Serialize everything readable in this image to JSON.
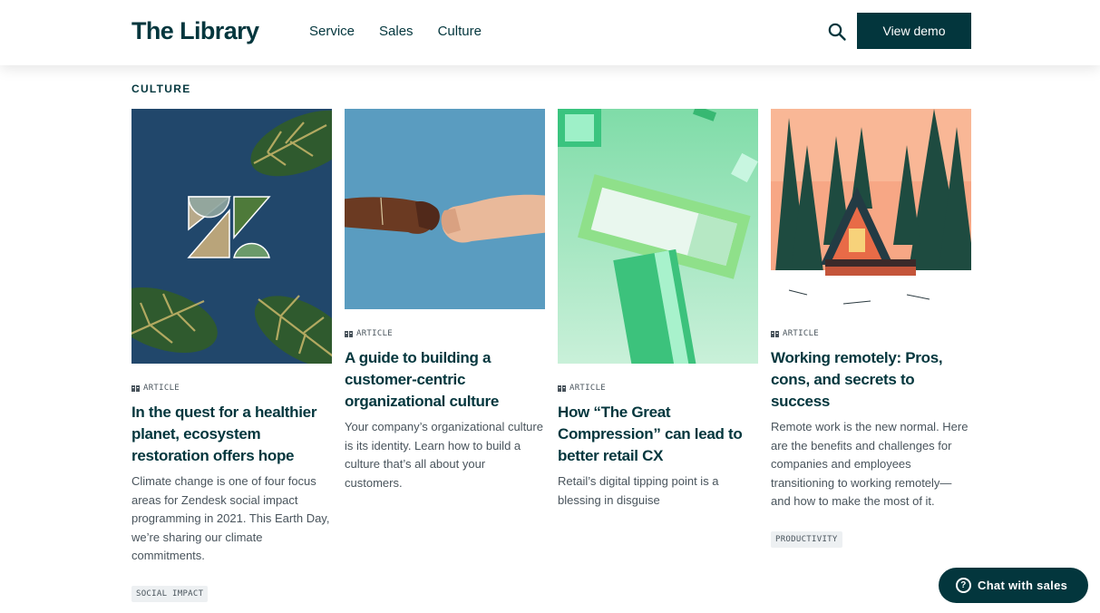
{
  "header": {
    "logo": "The Library",
    "nav": [
      "Service",
      "Sales",
      "Culture"
    ],
    "search_icon": "search-icon",
    "demo_label": "View demo"
  },
  "section": {
    "label": "CULTURE"
  },
  "cards": [
    {
      "type": "ARTICLE",
      "title": "In the quest for a healthier planet, ecosystem restoration offers hope",
      "description": "Climate change is one of four focus areas for Zendesk social impact programming in 2021. This Earth Day, we’re sharing our climate commitments.",
      "tag": "SOCIAL IMPACT"
    },
    {
      "type": "ARTICLE",
      "title": "A guide to building a customer-centric organizational culture",
      "description": "Your company’s organizational culture is its identity. Learn how to build a culture that’s all about your customers."
    },
    {
      "type": "ARTICLE",
      "title": "How “The Great Compression” can lead to better retail CX",
      "description": "Retail’s digital tipping point is a blessing in disguise"
    },
    {
      "type": "ARTICLE",
      "title": "Working remotely: Pros, cons, and secrets to success",
      "description": "Remote work is the new normal. Here are the benefits and challenges for companies and employees transitioning to working remotely—and how to make the most of it.",
      "tag": "PRODUCTIVITY"
    }
  ],
  "chat": {
    "label": "Chat with sales",
    "icon": "question-icon"
  },
  "colors": {
    "brand": "#03363d",
    "body_text": "#49545c",
    "tag_bg": "#edf0f2"
  }
}
